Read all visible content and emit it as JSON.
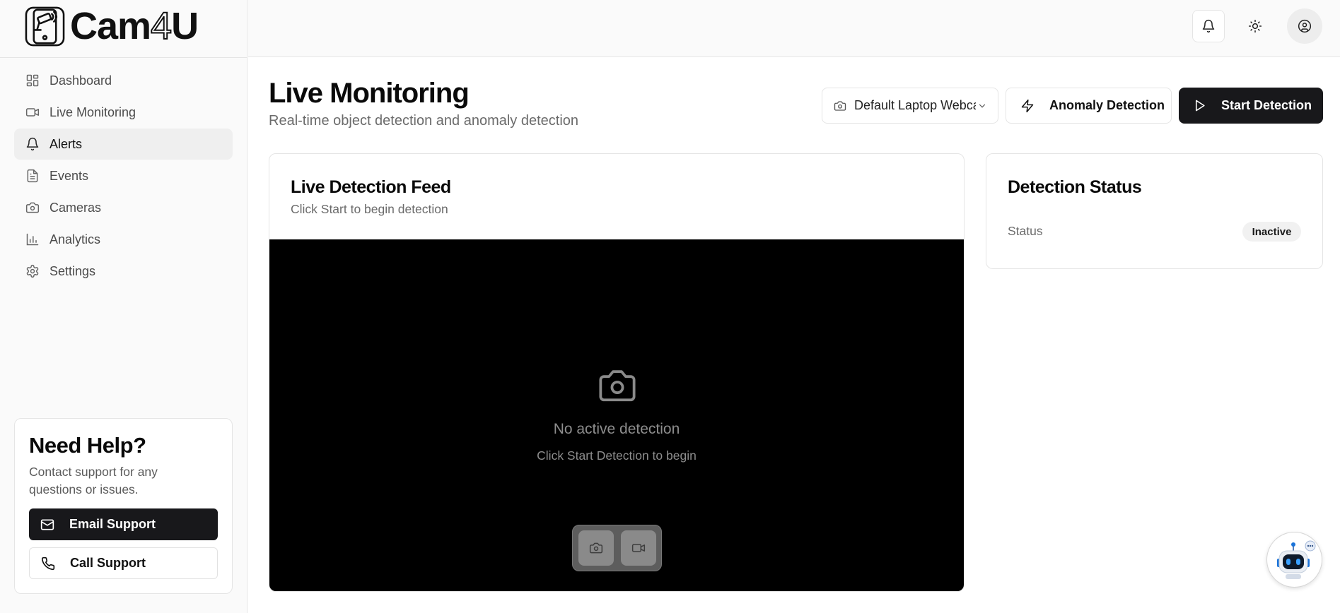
{
  "brand": {
    "name_prefix": "Cam",
    "name_digit": "4",
    "name_suffix": "U",
    "logo_icon": "cctv-phone-icon"
  },
  "sidebar": {
    "items": [
      {
        "label": "Dashboard",
        "icon": "layout-grid-icon",
        "active": false
      },
      {
        "label": "Live Monitoring",
        "icon": "video-camera-icon",
        "active": false
      },
      {
        "label": "Alerts",
        "icon": "bell-icon",
        "active": true
      },
      {
        "label": "Events",
        "icon": "file-text-icon",
        "active": false
      },
      {
        "label": "Cameras",
        "icon": "camera-icon",
        "active": false
      },
      {
        "label": "Analytics",
        "icon": "bar-chart-icon",
        "active": false
      },
      {
        "label": "Settings",
        "icon": "gear-icon",
        "active": false
      }
    ],
    "help": {
      "title": "Need Help?",
      "description": "Contact support for any questions or issues.",
      "email_label": "Email Support",
      "call_label": "Call Support"
    }
  },
  "topbar": {
    "notifications_icon": "bell-icon",
    "theme_icon": "sun-icon",
    "account_icon": "user-circle-icon"
  },
  "page": {
    "title": "Live Monitoring",
    "subtitle": "Real-time object detection and anomaly detection",
    "camera_select_value": "Default Laptop Webcam",
    "anomaly_label": "Anomaly Detection",
    "start_label": "Start Detection"
  },
  "feed": {
    "title": "Live Detection Feed",
    "subtitle": "Click Start to begin detection",
    "empty_title": "No active detection",
    "empty_subtitle": "Click Start Detection to begin"
  },
  "status": {
    "title": "Detection Status",
    "label": "Status",
    "value": "Inactive"
  },
  "colors": {
    "primary": "#18181b",
    "sidebar_bg": "#fafafa",
    "border": "#e5e5e5",
    "video_bg": "#000000",
    "bot_blue": "#1a73d9"
  }
}
